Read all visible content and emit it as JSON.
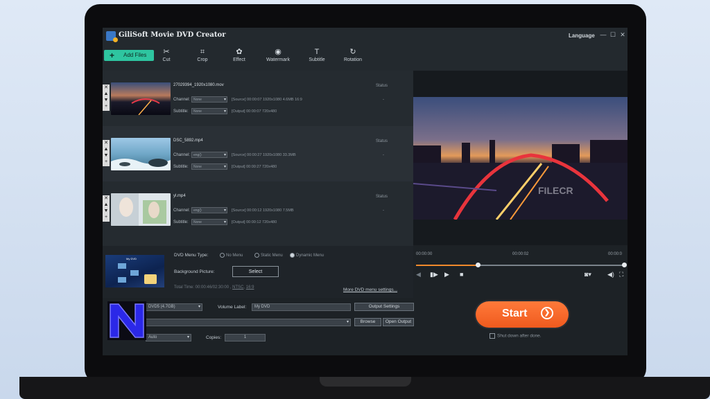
{
  "window": {
    "title": "GiliSoft Movie DVD Creator",
    "language": "Language",
    "minimize": "—",
    "maximize": "☐",
    "close": "✕"
  },
  "toolbar": {
    "add_files": "Add Files",
    "tools": [
      {
        "label": "Cut",
        "icon": "✂"
      },
      {
        "label": "Crop",
        "icon": "⌗"
      },
      {
        "label": "Effect",
        "icon": "✿"
      },
      {
        "label": "Watermark",
        "icon": "◉"
      },
      {
        "label": "Subtitle",
        "icon": "T"
      },
      {
        "label": "Rotation",
        "icon": "↻"
      }
    ]
  },
  "files": [
    {
      "name": "27029394_1920x1080.mov",
      "channel_label": "Channel:",
      "channel_value": "None",
      "subtitle_label": "Subtitle:",
      "subtitle_value": "None",
      "source": "[Source]  00:00:07  1920x1080  4.6MB  16:9",
      "output": "[Output]  00:00:07  720x480",
      "status_header": "Status",
      "status": "-"
    },
    {
      "name": "DSC_5892.mp4",
      "channel_label": "Channel:",
      "channel_value": "eng()",
      "subtitle_label": "Subtitle:",
      "subtitle_value": "None",
      "source": "[Source]  00:00:27  1920x1080  33.3MB",
      "output": "[Output]  00:00:27  720x480",
      "status_header": "Status",
      "status": "-"
    },
    {
      "name": "yl.mp4",
      "channel_label": "Channel:",
      "channel_value": "eng()",
      "subtitle_label": "Subtitle:",
      "subtitle_value": "None",
      "source": "[Source]  00:00:12  1920x1080  7.5MB",
      "output": "[Output]  00:00:12  720x480",
      "status_header": "Status",
      "status": "-"
    }
  ],
  "side_controls": [
    "✕",
    "▲",
    "▼",
    "+"
  ],
  "menu": {
    "thumb_title": "My DVD",
    "type_label": "DVD Menu Type:",
    "options": [
      "No Menu",
      "Static Menu",
      "Dynamic Menu"
    ],
    "background_label": "Background  Picture:",
    "select": "Select",
    "total_prefix": "Total Time: 00:00:46/02:30:00 ,",
    "ntsc": "NTSC",
    "ratio": "16:9",
    "more": "More DVD menu settings..."
  },
  "output": {
    "disc": "DVD5 (4.7GB)",
    "volume_label_text": "Volume Label:",
    "volume_label_value": "My DVD",
    "output_settings": "Output Settings",
    "path_value": "",
    "browse": "Browse",
    "open_output": "Open Output",
    "mode_value": "Auto",
    "copies_label": "Copies:",
    "copies_value": "1"
  },
  "player": {
    "time_start": "00:00:00",
    "time_mid": "00:00:02",
    "time_end": "00:00:0",
    "progress": 0.29,
    "watermark": "FILECR"
  },
  "start": {
    "label": "Start",
    "shutdown": "Shut down after done."
  },
  "colors": {
    "accent": "#2ec5a0",
    "start": "#f06a2a",
    "progress": "#f08a2c"
  }
}
